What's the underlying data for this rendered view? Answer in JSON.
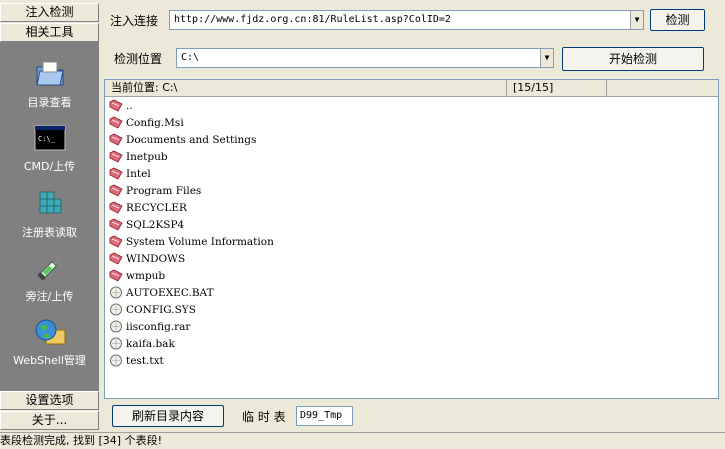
{
  "sidebar": {
    "top_tabs": [
      "注入检测",
      "相关工具"
    ],
    "items": [
      {
        "label": "目录查看",
        "icon": "folder-icon"
      },
      {
        "label": "CMD/上传",
        "icon": "terminal-icon"
      },
      {
        "label": "注册表读取",
        "icon": "registry-icon"
      },
      {
        "label": "旁注/上传",
        "icon": "syringe-icon"
      },
      {
        "label": "WebShell管理",
        "icon": "globe-folder-icon"
      }
    ],
    "bottom_tabs": [
      "设置选项",
      "关于..."
    ]
  },
  "inject": {
    "label": "注入连接",
    "url": "http://www.fjdz.org.cn:81/RuleList.asp?ColID=2",
    "detect_button": "检测"
  },
  "location": {
    "label": "检测位置",
    "value": "C:\\",
    "start_button": "开始检测"
  },
  "list": {
    "header_path": "当前位置: C:\\",
    "header_count": "[15/15]",
    "entries": [
      {
        "name": "..",
        "type": "folder"
      },
      {
        "name": "Config.Msi",
        "type": "folder"
      },
      {
        "name": "Documents and Settings",
        "type": "folder"
      },
      {
        "name": "Inetpub",
        "type": "folder"
      },
      {
        "name": "Intel",
        "type": "folder"
      },
      {
        "name": "Program Files",
        "type": "folder"
      },
      {
        "name": "RECYCLER",
        "type": "folder"
      },
      {
        "name": "SQL2KSP4",
        "type": "folder"
      },
      {
        "name": "System Volume Information",
        "type": "folder"
      },
      {
        "name": "WINDOWS",
        "type": "folder"
      },
      {
        "name": "wmpub",
        "type": "folder"
      },
      {
        "name": "AUTOEXEC.BAT",
        "type": "file"
      },
      {
        "name": "CONFIG.SYS",
        "type": "file"
      },
      {
        "name": "iisconfig.rar",
        "type": "file"
      },
      {
        "name": "kaifa.bak",
        "type": "file"
      },
      {
        "name": "test.txt",
        "type": "file"
      }
    ]
  },
  "bottom": {
    "refresh_button": "刷新目录内容",
    "temp_label": "临 时 表",
    "temp_value": "D99_Tmp"
  },
  "status": "表段检测完成, 找到 [34] 个表段!"
}
